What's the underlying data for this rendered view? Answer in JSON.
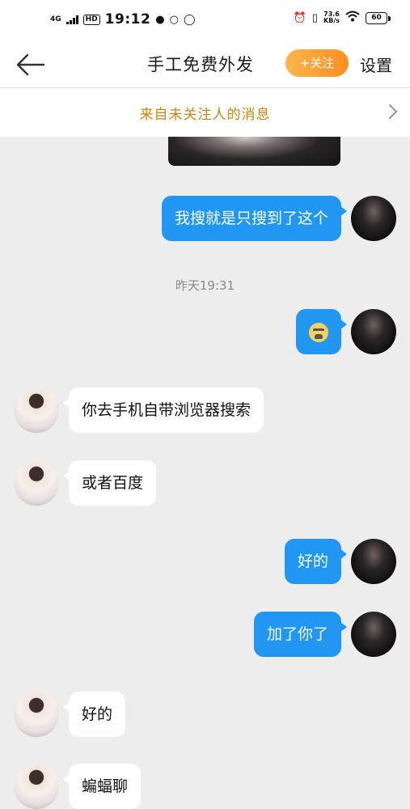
{
  "status_bar": {
    "network": "4G",
    "hd": "HD",
    "time": "19:12",
    "speed_value": "73.6",
    "speed_unit": "KB/s",
    "battery": "60"
  },
  "nav": {
    "title": "手工免费外发",
    "follow_label": "+关注",
    "settings_label": "设置"
  },
  "notice": {
    "text": "来自未关注人的消息"
  },
  "messages": [
    {
      "from": "me",
      "text": "我搜就是只搜到了这个"
    },
    {
      "from": "me",
      "emoji": "crying-face"
    },
    {
      "from": "them",
      "text": "你去手机自带浏览器搜索"
    },
    {
      "from": "them",
      "text": "或者百度"
    },
    {
      "from": "me",
      "text": "好的"
    },
    {
      "from": "me",
      "text": "加了你了"
    },
    {
      "from": "them",
      "text": "好的"
    },
    {
      "from": "them",
      "text": "蝙蝠聊"
    }
  ],
  "timestamp": "昨天19:31",
  "colors": {
    "outgoing_bubble": "#2196f3",
    "incoming_bubble": "#ffffff",
    "follow_button": "#ff9a2e",
    "notice_text": "#c9860e",
    "chat_background": "#ededed"
  }
}
